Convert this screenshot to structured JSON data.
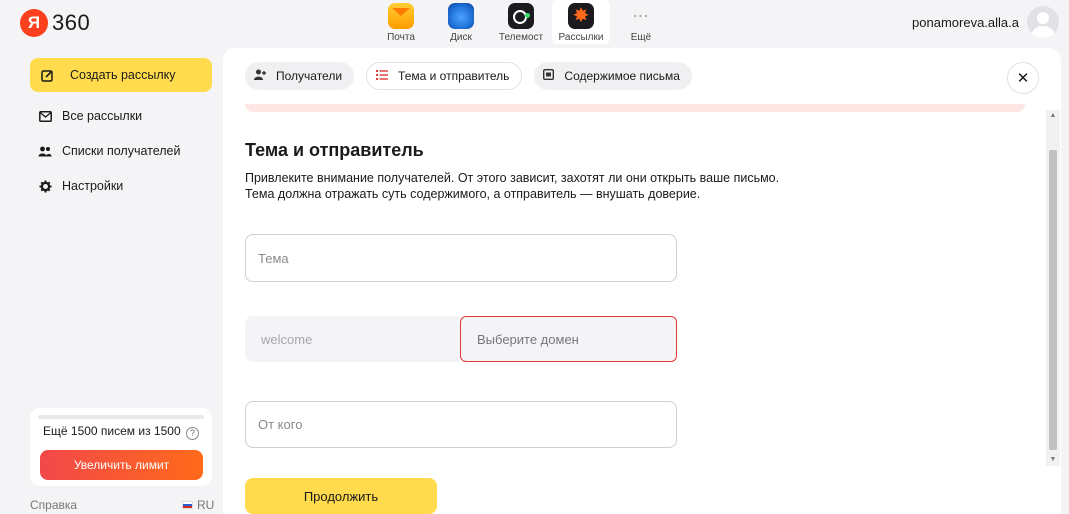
{
  "header": {
    "logo_badge": "Я",
    "logo_text": "360",
    "apps": [
      {
        "label": "Почта",
        "icon": "mail-icon"
      },
      {
        "label": "Диск",
        "icon": "disk-icon"
      },
      {
        "label": "Телемост",
        "icon": "telemost-icon"
      },
      {
        "label": "Рассылки",
        "icon": "mailings-icon"
      },
      {
        "label": "Ещё",
        "icon": "more-icon"
      }
    ],
    "more_glyph": "⋯",
    "user_name": "ponamoreva.alla.a"
  },
  "sidebar": {
    "create_label": "Создать рассылку",
    "items": [
      {
        "label": "Все рассылки",
        "icon": "envelope-icon"
      },
      {
        "label": "Списки получателей",
        "icon": "users-icon"
      },
      {
        "label": "Настройки",
        "icon": "gear-icon"
      }
    ],
    "limit_text": "Ещё 1500 писем из 1500",
    "limit_help": "?",
    "limit_button": "Увеличить лимит",
    "help_link": "Справка",
    "language": "RU"
  },
  "tabs": [
    {
      "label": "Получатели",
      "icon": "add-user-icon"
    },
    {
      "label": "Тема и отправитель",
      "icon": "list-icon"
    },
    {
      "label": "Содержимое письма",
      "icon": "document-icon"
    }
  ],
  "close_glyph": "✕",
  "form": {
    "title": "Тема и отправитель",
    "description_line1": "Привлеките внимание получателей. От этого зависит, захотят ли они открыть ваше письмо.",
    "description_line2": "Тема должна отражать суть содержимого, а отправитель — внушать доверие.",
    "subject_placeholder": "Тема",
    "sender_local": "welcome",
    "domain_placeholder": "Выберите домен",
    "from_placeholder": "От кого",
    "continue_label": "Продолжить"
  },
  "colors": {
    "accent_yellow": "#ffdb4d",
    "error_red": "#e03a3a",
    "limit_gradient_start": "#f2484a",
    "limit_gradient_end": "#ff6a1a"
  }
}
